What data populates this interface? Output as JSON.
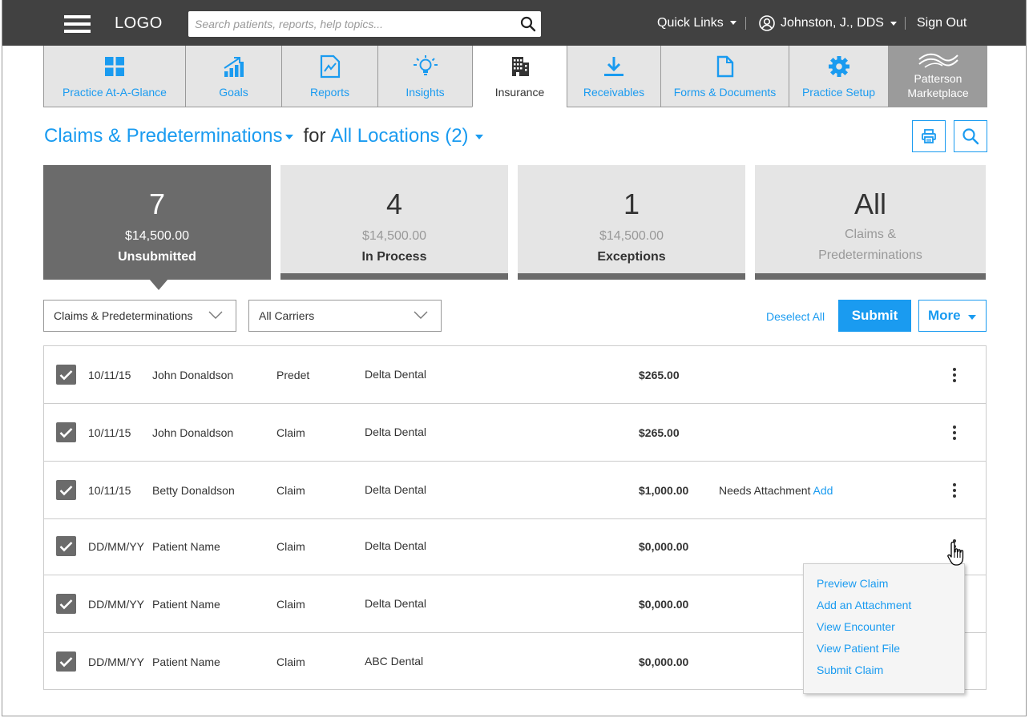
{
  "header": {
    "logo": "LOGO",
    "search_placeholder": "Search patients, reports, help topics...",
    "quick_links": "Quick Links",
    "user_name": "Johnston, J., DDS",
    "sign_out": "Sign Out"
  },
  "nav": {
    "tabs": [
      {
        "label": "Practice At-A-Glance",
        "icon": "grid-icon"
      },
      {
        "label": "Goals",
        "icon": "bar-chart-icon"
      },
      {
        "label": "Reports",
        "icon": "report-icon"
      },
      {
        "label": "Insights",
        "icon": "lightbulb-icon"
      },
      {
        "label": "Insurance",
        "icon": "building-icon",
        "active": true
      },
      {
        "label": "Receivables",
        "icon": "download-icon"
      },
      {
        "label": "Forms & Documents",
        "icon": "document-icon"
      },
      {
        "label": "Practice Setup",
        "icon": "gear-icon"
      },
      {
        "label": "Patterson Marketplace",
        "icon": "patterson-logo",
        "line1": "Patterson",
        "line2": "Marketplace"
      }
    ]
  },
  "heading": {
    "title": "Claims & Predeterminations",
    "for": "for",
    "locations": "All Locations (2)"
  },
  "cards": [
    {
      "count": "7",
      "amount": "$14,500.00",
      "label": "Unsubmitted",
      "active": true
    },
    {
      "count": "4",
      "amount": "$14,500.00",
      "label": "In Process"
    },
    {
      "count": "1",
      "amount": "$14,500.00",
      "label": "Exceptions"
    },
    {
      "count": "All",
      "sub1": "Claims &",
      "sub2": "Predeterminations"
    }
  ],
  "filters": {
    "type": "Claims & Predeterminations",
    "carrier": "All Carriers",
    "deselect_all": "Deselect All",
    "submit": "Submit",
    "more": "More"
  },
  "rows": [
    {
      "date": "10/11/15",
      "name": "John Donaldson",
      "type": "Predet",
      "carrier": "Delta Dental",
      "amount": "$265.00",
      "note": "",
      "note_link": ""
    },
    {
      "date": "10/11/15",
      "name": "John Donaldson",
      "type": "Claim",
      "carrier": "Delta Dental",
      "amount": "$265.00",
      "note": "",
      "note_link": ""
    },
    {
      "date": "10/11/15",
      "name": "Betty Donaldson",
      "type": "Claim",
      "carrier": "Delta Dental",
      "amount": "$1,000.00",
      "note": "Needs Attachment",
      "note_link": "Add"
    },
    {
      "date": "DD/MM/YY",
      "name": "Patient Name",
      "type": "Claim",
      "carrier": "Delta Dental",
      "amount": "$0,000.00",
      "note": "",
      "note_link": ""
    },
    {
      "date": "DD/MM/YY",
      "name": "Patient Name",
      "type": "Claim",
      "carrier": "Delta Dental",
      "amount": "$0,000.00",
      "note": "",
      "note_link": ""
    },
    {
      "date": "DD/MM/YY",
      "name": "Patient Name",
      "type": "Claim",
      "carrier": "ABC Dental",
      "amount": "$0,000.00",
      "note": "",
      "note_link": ""
    }
  ],
  "row_menu": {
    "items": [
      "Preview Claim",
      "Add an Attachment",
      "View Encounter",
      "View Patient File",
      "Submit Claim"
    ]
  },
  "colors": {
    "accent": "#1a9bf0",
    "topbar": "#414141",
    "active_card": "#6b6b6b",
    "tab_bg": "#e5e5e5"
  }
}
